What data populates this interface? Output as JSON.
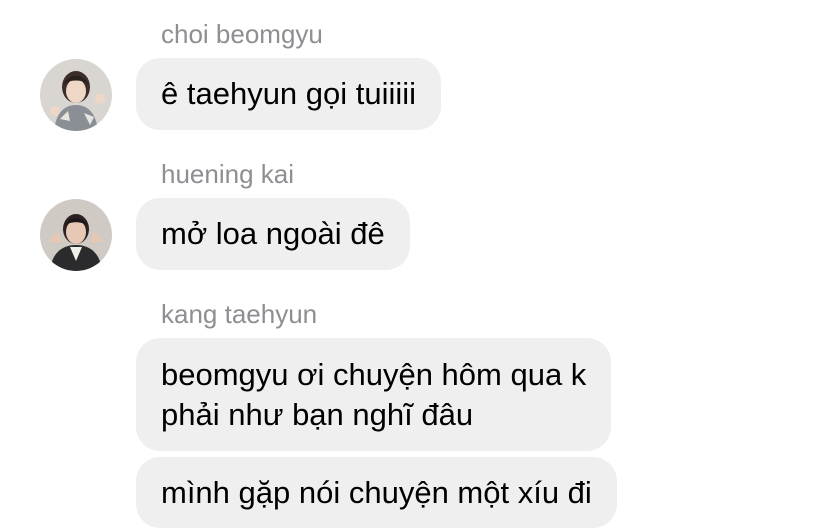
{
  "messages": [
    {
      "sender": "choi beomgyu",
      "avatar_icon": "user-avatar-beomgyu",
      "bubbles": [
        "ê taehyun gọi tuiiiii"
      ]
    },
    {
      "sender": "huening kai",
      "avatar_icon": "user-avatar-huening-kai",
      "bubbles": [
        "mở loa ngoài đê"
      ]
    },
    {
      "sender": "kang taehyun",
      "avatar_icon": null,
      "bubbles": [
        "beomgyu ơi chuyện hôm qua k\nphải như bạn nghĩ đâu",
        "mình gặp nói chuyện một xíu đi"
      ]
    }
  ],
  "colors": {
    "bubble_bg": "#efefef",
    "sender_text": "#8e8e93",
    "message_text": "#000000"
  }
}
